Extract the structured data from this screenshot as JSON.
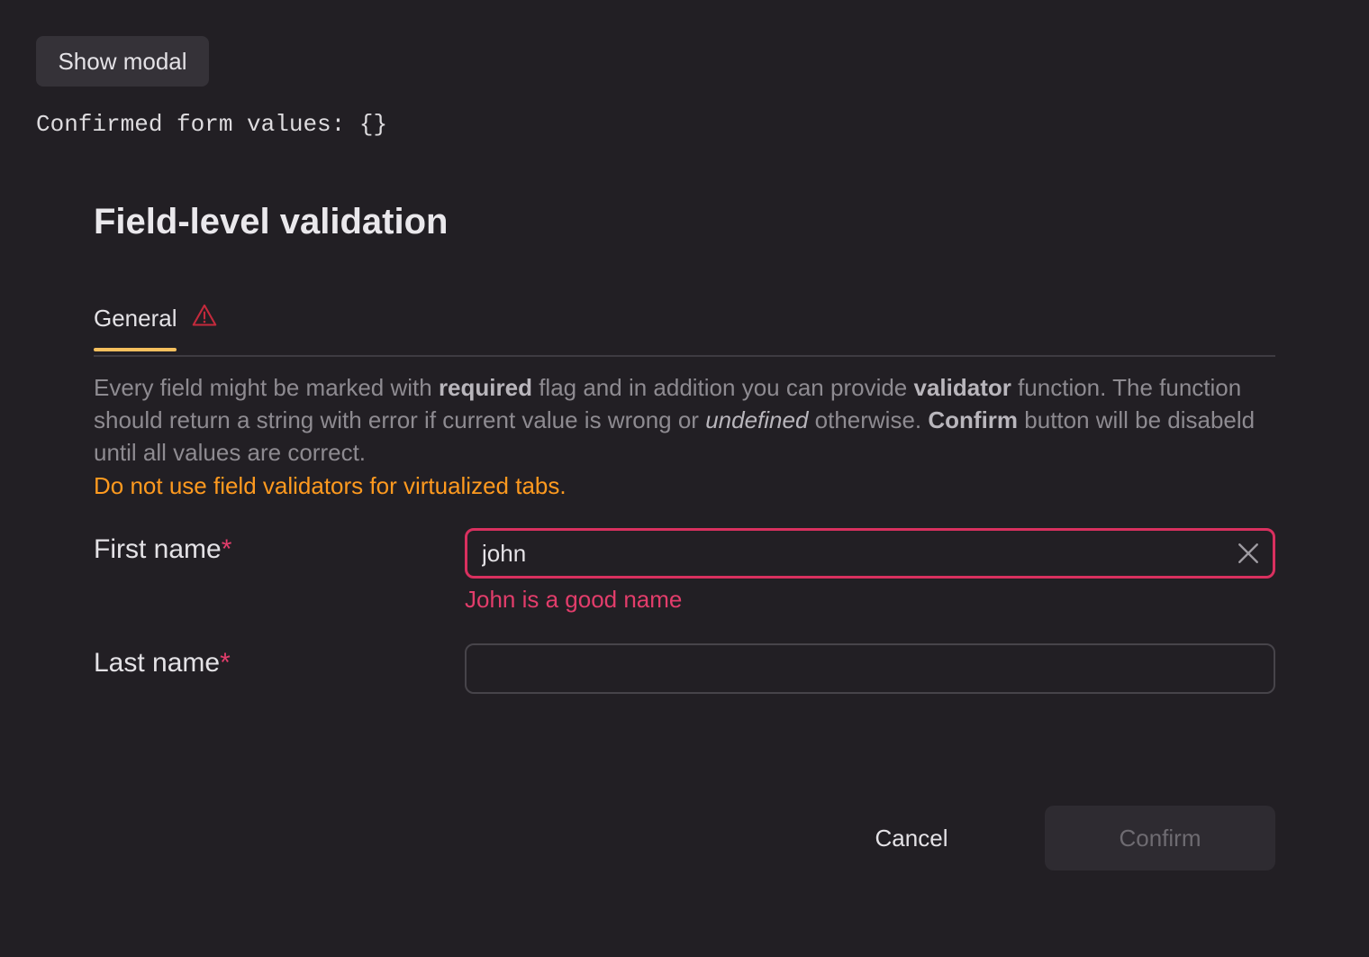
{
  "top": {
    "show_modal_label": "Show modal",
    "confirmed_text": "Confirmed form values: {}"
  },
  "modal": {
    "title": "Field-level validation",
    "tabs": [
      {
        "label": "General",
        "active": true,
        "has_error": true,
        "icon": "warning-triangle-icon"
      }
    ],
    "description": {
      "p1": "Every field might be marked with ",
      "b1": "required",
      "p2": " flag and in addition you can provide ",
      "b2": "validator",
      "p3": " function. The function should return a string with error if current value is wrong or ",
      "i1": "undefined",
      "p4": " otherwise. ",
      "b3": "Confirm",
      "p5": " button will be disabeld until all values are correct."
    },
    "warning_note": "Do not use field validators for virtualized tabs.",
    "fields": [
      {
        "label": "First name",
        "required_mark": "*",
        "value": "john",
        "placeholder": "",
        "error": "John is a good name",
        "clear_icon": "close-icon"
      },
      {
        "label": "Last name",
        "required_mark": "*",
        "value": "",
        "placeholder": "",
        "error": ""
      }
    ],
    "actions": {
      "cancel_label": "Cancel",
      "confirm_label": "Confirm",
      "confirm_disabled": true
    }
  },
  "colors": {
    "background": "#221f24",
    "accent_tab": "#f5c05e",
    "error": "#e23d6b",
    "warning": "#ff9a1f"
  }
}
